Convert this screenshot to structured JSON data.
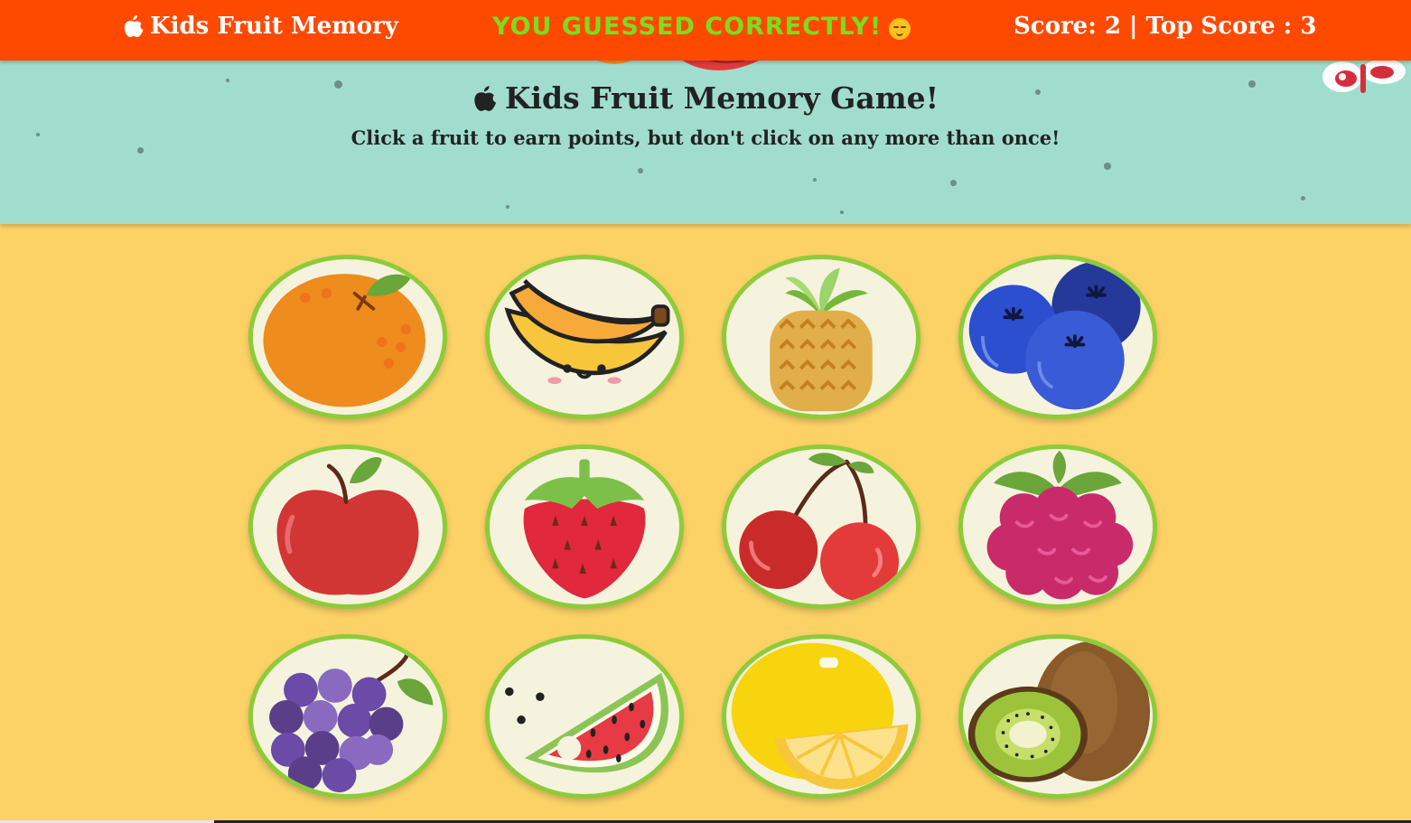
{
  "navbar": {
    "brand_label": "Kids Fruit Memory",
    "brand_icon": "apple-icon",
    "status_message": "YOU GUESSED CORRECTLY!",
    "status_emoji": "relieved-face-icon",
    "score_text": "Score: 2 | Top Score : 3"
  },
  "hero": {
    "title": "Kids Fruit Memory Game!",
    "title_icon": "apple-icon",
    "instructions": "Click a fruit to earn points, but don't click on any more than once!"
  },
  "cards": [
    {
      "fruit": "orange"
    },
    {
      "fruit": "banana"
    },
    {
      "fruit": "pineapple"
    },
    {
      "fruit": "blueberries"
    },
    {
      "fruit": "apple"
    },
    {
      "fruit": "strawberry"
    },
    {
      "fruit": "cherries"
    },
    {
      "fruit": "raspberry"
    },
    {
      "fruit": "grapes"
    },
    {
      "fruit": "watermelon"
    },
    {
      "fruit": "lemon"
    },
    {
      "fruit": "kiwi"
    }
  ],
  "colors": {
    "navbar": "#fe4a01",
    "status": "#7ddc1f",
    "hero": "#a1ddce",
    "background": "#fcd267",
    "card_border": "#8ecb3a",
    "card_fill": "#f5f3dd"
  }
}
